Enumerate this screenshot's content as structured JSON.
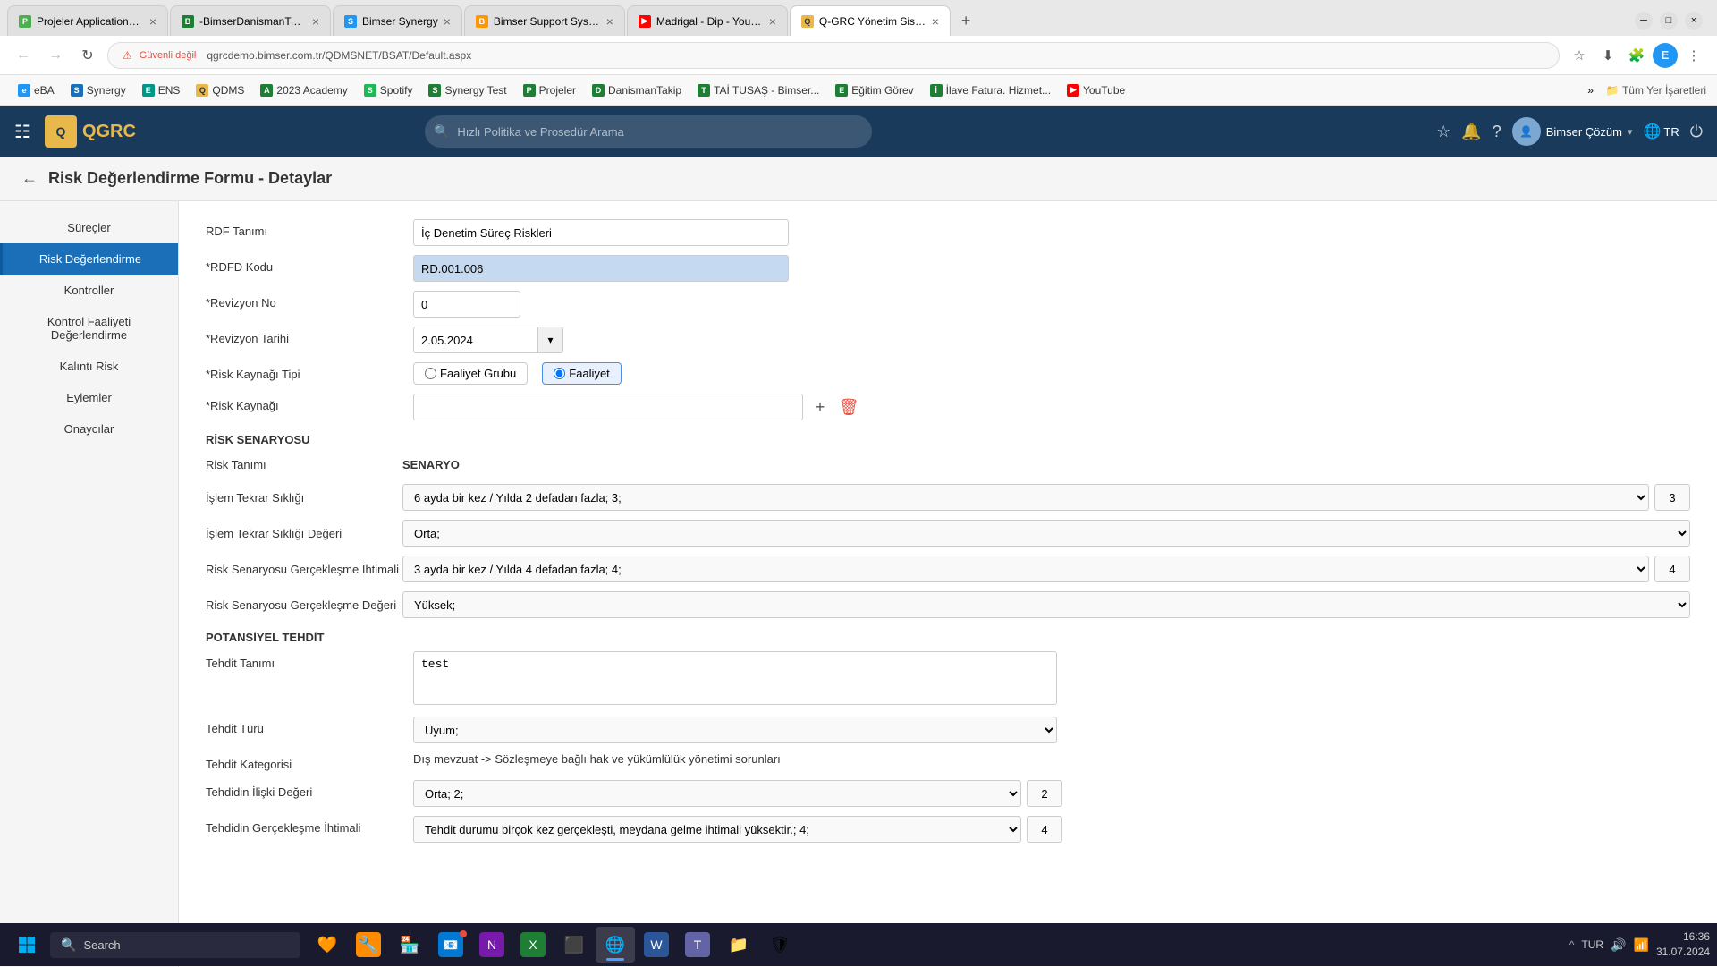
{
  "browser": {
    "tabs": [
      {
        "id": "tab1",
        "label": "Projeler Applications Bun...",
        "favicon_color": "#4caf50",
        "favicon_letter": "P",
        "active": false
      },
      {
        "id": "tab2",
        "label": "-BimserDanismanTakip202...",
        "favicon_color": "#1e7e34",
        "favicon_letter": "B",
        "active": false
      },
      {
        "id": "tab3",
        "label": "Bimser Synergy",
        "favicon_color": "#2196f3",
        "favicon_letter": "S",
        "active": false
      },
      {
        "id": "tab4",
        "label": "Bimser Support System",
        "favicon_color": "#ff9800",
        "favicon_letter": "B",
        "active": false
      },
      {
        "id": "tab5",
        "label": "Madrigal - Dip - YouTu...",
        "favicon_color": "#ff0000",
        "favicon_letter": "▶",
        "active": false
      },
      {
        "id": "tab6",
        "label": "Q-GRC Yönetim Sistemi",
        "favicon_color": "#e8b84b",
        "favicon_letter": "Q",
        "active": true
      }
    ],
    "address": "qgrcdemo.bimser.com.tr/QDMSNET/BSAT/Default.aspx",
    "lock_label": "Güvenli değil"
  },
  "bookmarks": [
    {
      "label": "eBA",
      "color": "#2196f3",
      "letter": "e"
    },
    {
      "label": "Synergy",
      "color": "#1a6fb8",
      "letter": "S"
    },
    {
      "label": "ENS",
      "color": "#009688",
      "letter": "E"
    },
    {
      "label": "QDMS",
      "color": "#e8b84b",
      "letter": "Q"
    },
    {
      "label": "2023 Academy",
      "color": "#1e7e34",
      "letter": "A"
    },
    {
      "label": "Spotify",
      "color": "#1db954",
      "letter": "S"
    },
    {
      "label": "Synergy Test",
      "color": "#1e7e34",
      "letter": "S"
    },
    {
      "label": "Projeler",
      "color": "#1e7e34",
      "letter": "P"
    },
    {
      "label": "DanismanTakip",
      "color": "#1e7e34",
      "letter": "D"
    },
    {
      "label": "TAİ TUSAŞ - Bimser...",
      "color": "#1e7e34",
      "letter": "T"
    },
    {
      "label": "Eğitim Görev",
      "color": "#1e7e34",
      "letter": "E"
    },
    {
      "label": "İlave Fatura. Hizmet...",
      "color": "#1e7e34",
      "letter": "İ"
    },
    {
      "label": "YouTube",
      "color": "#ff0000",
      "letter": "▶"
    }
  ],
  "app_header": {
    "logo_q": "Q",
    "logo_grc": "GRC",
    "search_placeholder": "Hızlı Politika ve Prosedür Arama",
    "user_name": "Bimser Çözüm",
    "lang": "TR"
  },
  "page": {
    "title": "Risk Değerlendirme Formu - Detaylar",
    "back_label": "←"
  },
  "sidebar": {
    "items": [
      {
        "label": "Süreçler",
        "active": false
      },
      {
        "label": "Risk Değerlendirme",
        "active": true
      },
      {
        "label": "Kontroller",
        "active": false
      },
      {
        "label": "Kontrol Faaliyeti Değerlendirme",
        "active": false
      },
      {
        "label": "Kalıntı Risk",
        "active": false
      },
      {
        "label": "Eylemler",
        "active": false
      },
      {
        "label": "Onaycılar",
        "active": false
      }
    ]
  },
  "form": {
    "rdf_tanimi_label": "RDF Tanımı",
    "rdf_tanimi_value": "İç Denetim Süreç Riskleri",
    "rdfd_kodu_label": "*RDFD Kodu",
    "rdfd_kodu_value": "RD.001.006",
    "revizyon_no_label": "*Revizyon No",
    "revizyon_no_value": "0",
    "revizyon_tarihi_label": "*Revizyon Tarihi",
    "revizyon_tarihi_value": "2.05.2024",
    "risk_kaynagi_tipi_label": "*Risk Kaynağı Tipi",
    "radio_faaliyet_grubu": "Faaliyet Grubu",
    "radio_faaliyet": "Faaliyet",
    "risk_kaynagi_label": "*Risk Kaynağı",
    "risk_kaynagi_value": "",
    "risk_senaryosu_header": "RİSK SENARYOSU",
    "risk_tanimi_label": "Risk Tanımı",
    "islem_tekrar_sikligi_label": "İşlem Tekrar Sıklığı",
    "islem_tekrar_deger_label": "İşlem Tekrar Sıklığı Değeri",
    "senaryo_label": "SENARYO",
    "senaryo_row1_value": "6 ayda bir kez / Yılda 2 defadan fazla; 3;",
    "senaryo_row1_num": "3",
    "senaryo_row2_value": "Orta;",
    "risk_senaryosu_label": "Risk Senaryosu Gerçekleşme İhtimali",
    "risk_senaryosu_deger_label": "Risk Senaryosu Gerçekleşme Değeri",
    "senaryo_row3_value": "3 ayda bir kez / Yılda 4 defadan fazla; 4;",
    "senaryo_row3_num": "4",
    "senaryo_row4_value": "Yüksek;",
    "potansiyel_tehdit_header": "POTANSİYEL TEHDİT",
    "tehdit_tanimi_label": "Tehdit Tanımı",
    "tehdit_tanimi_value": "test",
    "tehdit_turu_label": "Tehdit Türü",
    "tehdit_turu_value": "Uyum;",
    "tehdit_kategorisi_label": "Tehdit Kategorisi",
    "tehdit_kategorisi_value": "Dış mevzuat -> Sözleşmeye bağlı hak ve yükümlülük yönetimi sorunları",
    "tehdidin_ilski_degeri_label": "Tehdidin İlişki Değeri",
    "tehdidin_ilski_degeri_value": "Orta; 2;",
    "tehdidin_ilski_num": "2",
    "tehdidin_gerceklesme_label": "Tehdidin Gerçekleşme İhtimali",
    "tehdidin_gerceklesme_value": "Tehdit durumu birçok kez gerçekleşti, meydana gelme ihtimali yüksektir.; 4;",
    "tehdidin_gerceklesme_num": "4"
  },
  "taskbar": {
    "search_placeholder": "Search",
    "time": "16:36",
    "date": "31.07.2024",
    "lang": "TUR"
  }
}
